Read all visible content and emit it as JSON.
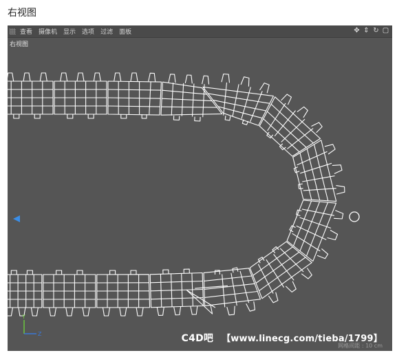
{
  "caption": "右视图",
  "menu": {
    "items": [
      "查看",
      "摄像机",
      "显示",
      "选项",
      "过滤",
      "面板"
    ]
  },
  "viewport": {
    "label": "右视图",
    "grid_spacing_text": "网格间距 : 10 cm",
    "nav_icons": [
      "move-icon",
      "zoom-icon",
      "rotate-icon",
      "maximize-icon"
    ]
  },
  "watermark": {
    "brand": "C4D吧",
    "url": "【www.linecg.com/tieba/1799】"
  },
  "colors": {
    "viewport_bg": "#555555",
    "wire": "#ffffff",
    "axis_y": "#6ccf3c",
    "axis_z": "#3a78d8",
    "pivot_marker": "#3a8ee8"
  }
}
